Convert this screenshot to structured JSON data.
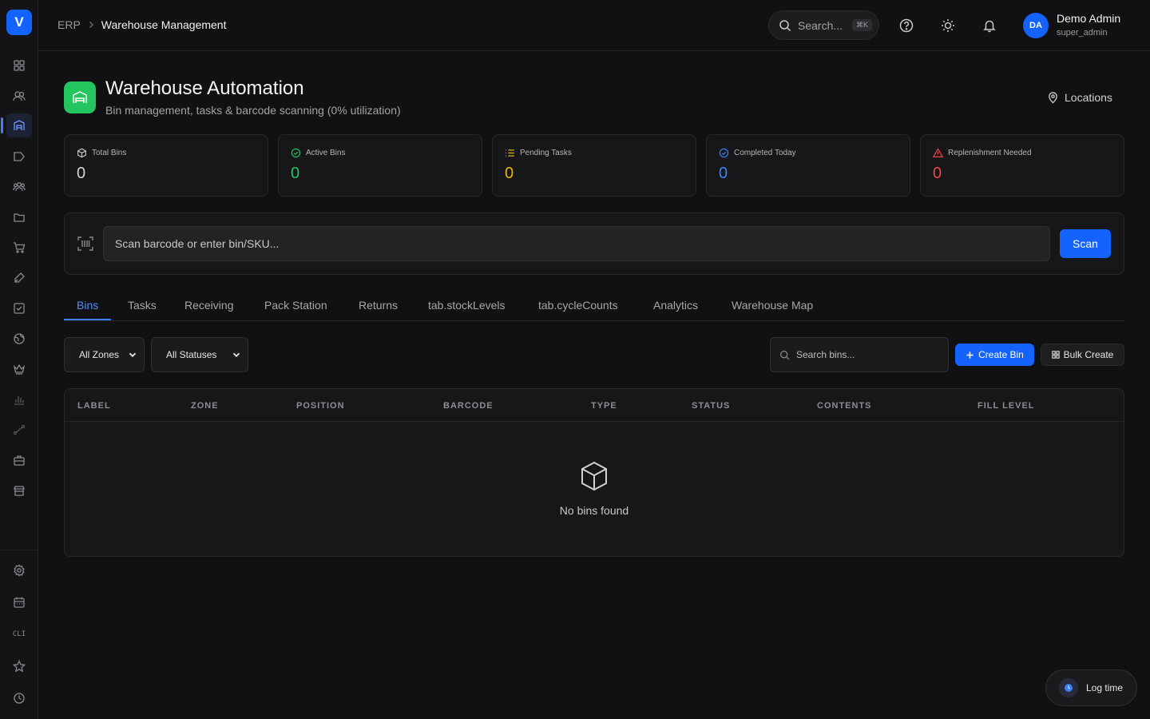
{
  "sidebar": {
    "logo": "V",
    "cli_label": "CLI",
    "icons": [
      "dashboard-icon",
      "users-icon",
      "warehouse-icon",
      "tag-icon",
      "team-icon",
      "folder-icon",
      "cart-icon",
      "pen-icon",
      "checklist-icon",
      "globe-icon",
      "crown-icon",
      "chart-icon",
      "route-icon",
      "briefcase-icon",
      "store-icon",
      "settings-icon",
      "calendar-icon",
      "cli-icon",
      "star-icon",
      "clock-icon"
    ],
    "active": "warehouse-icon"
  },
  "header": {
    "breadcrumb_root": "ERP",
    "breadcrumb_current": "Warehouse Management",
    "search_placeholder": "Search...",
    "search_shortcut": "⌘K",
    "user_initials": "DA",
    "user_name": "Demo Admin",
    "user_role": "super_admin"
  },
  "page": {
    "title": "Warehouse Automation",
    "subtitle": "Bin management, tasks & barcode scanning (0% utilization)",
    "locations_label": "Locations",
    "accent": "#22c55e"
  },
  "stats": [
    {
      "label": "Total Bins",
      "value": "0",
      "color": "#d6d6da"
    },
    {
      "label": "Active Bins",
      "value": "0",
      "color": "#22c55e"
    },
    {
      "label": "Pending Tasks",
      "value": "0",
      "color": "#eab308"
    },
    {
      "label": "Completed Today",
      "value": "0",
      "color": "#3b82f6"
    },
    {
      "label": "Replenishment Needed",
      "value": "0",
      "color": "#ef4444"
    }
  ],
  "scan": {
    "placeholder": "Scan barcode or enter bin/SKU...",
    "button": "Scan"
  },
  "tabs": [
    "Bins",
    "Tasks",
    "Receiving",
    "Pack Station",
    "Returns",
    "tab.stockLevels",
    "tab.cycleCounts",
    "Analytics",
    "Warehouse Map"
  ],
  "active_tab": "Bins",
  "filters": {
    "zone": "All Zones",
    "status": "All Statuses",
    "search_placeholder": "Search bins...",
    "create_label": "Create Bin",
    "bulk_label": "Bulk Create"
  },
  "table": {
    "columns": [
      "LABEL",
      "ZONE",
      "POSITION",
      "BARCODE",
      "TYPE",
      "STATUS",
      "CONTENTS",
      "FILL LEVEL"
    ],
    "empty_text": "No bins found"
  },
  "log_time": "Log time",
  "colors": {
    "primary": "#1463ff"
  }
}
